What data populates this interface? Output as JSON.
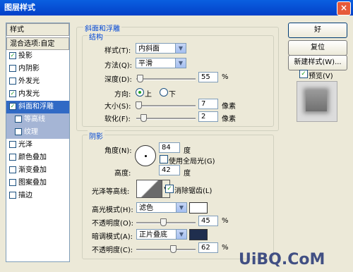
{
  "window": {
    "title": "图层样式",
    "close_label": "×"
  },
  "left_panel": {
    "header": "样式",
    "items": [
      {
        "label": "混合选项:自定",
        "checked": null
      },
      {
        "label": "投影",
        "checked": "✓"
      },
      {
        "label": "内阴影",
        "checked": ""
      },
      {
        "label": "外发光",
        "checked": ""
      },
      {
        "label": "内发光",
        "checked": "✓"
      },
      {
        "label": "斜面和浮雕",
        "checked": "✓"
      },
      {
        "label": "等高线",
        "checked": ""
      },
      {
        "label": "纹理",
        "checked": ""
      },
      {
        "label": "光泽",
        "checked": ""
      },
      {
        "label": "颜色叠加",
        "checked": ""
      },
      {
        "label": "渐变叠加",
        "checked": ""
      },
      {
        "label": "图案叠加",
        "checked": ""
      },
      {
        "label": "描边",
        "checked": ""
      }
    ]
  },
  "bevel_group": {
    "title": "斜面和浮雕",
    "structure_title": "结构",
    "style_label": "样式(T):",
    "style_value": "内斜面",
    "technique_label": "方法(Q):",
    "technique_value": "平滑",
    "depth_label": "深度(D):",
    "depth_value": "55",
    "depth_unit": "%",
    "depth_level": 0.055,
    "direction_label": "方向:",
    "direction_up": "上",
    "direction_down": "下",
    "size_label": "大小(S):",
    "size_value": "7",
    "size_unit": "像素",
    "size_level": 0.03,
    "soften_label": "软化(F):",
    "soften_value": "2",
    "soften_unit": "像素",
    "soften_level": 0.12
  },
  "shading_group": {
    "title": "阴影",
    "angle_label": "角度(N):",
    "angle_value": "84",
    "angle_unit": "度",
    "global_light_label": "使用全局光(G)",
    "global_light_checked": "",
    "altitude_label": "高度:",
    "altitude_value": "42",
    "altitude_unit": "度",
    "gloss_label": "光泽等高线:",
    "antialias_label": "消除锯齿(L)",
    "antialias_checked": "✓",
    "highlight_mode_label": "高光模式(H):",
    "highlight_mode_value": "滤色",
    "highlight_color": "#ffffff",
    "highlight_opacity_label": "不透明度(O):",
    "highlight_opacity_value": "45",
    "highlight_opacity_unit": "%",
    "highlight_opacity_level": 0.45,
    "shadow_mode_label": "暗调模式(A):",
    "shadow_mode_value": "正片叠底",
    "shadow_color": "#1f2e4e",
    "shadow_opacity_label": "不透明度(C):",
    "shadow_opacity_value": "62",
    "shadow_opacity_unit": "%",
    "shadow_opacity_level": 0.62
  },
  "right_buttons": {
    "ok": "好",
    "reset": "复位",
    "new_style": "新建样式(W)...",
    "preview_label": "预览(V)",
    "preview_checked": "✓"
  },
  "watermark": {
    "text": "UiBQ.CoM"
  }
}
